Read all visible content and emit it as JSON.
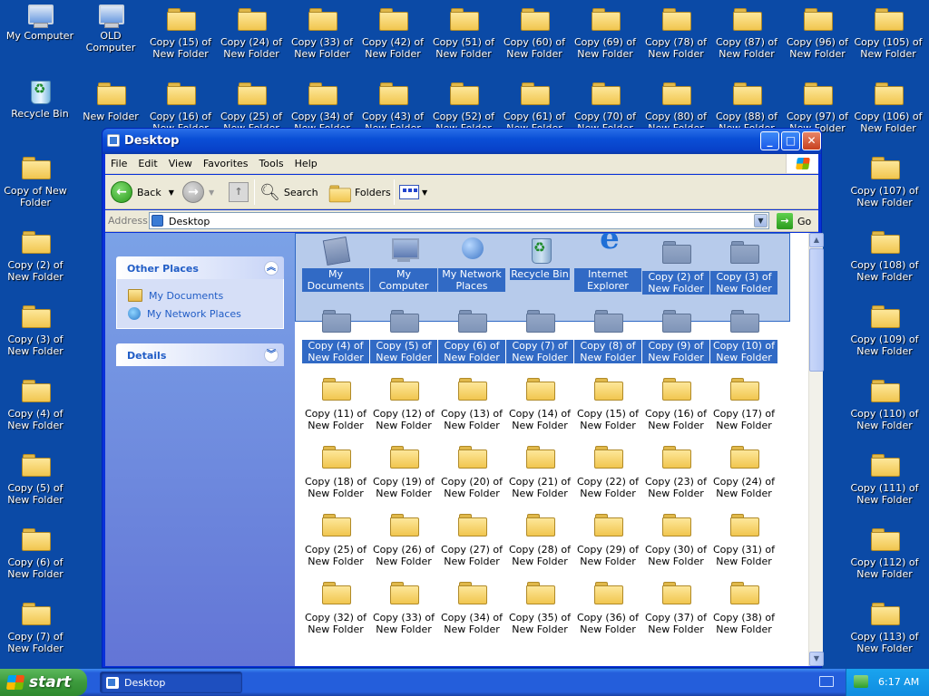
{
  "desktop": {
    "icons": [
      {
        "label": "My Computer",
        "type": "pc"
      },
      {
        "label": "OLD Computer",
        "type": "pc"
      },
      {
        "label": "Copy (15) of New Folder",
        "type": "folder"
      },
      {
        "label": "Copy (24) of New Folder",
        "type": "folder"
      },
      {
        "label": "Copy (33) of New Folder",
        "type": "folder"
      },
      {
        "label": "Copy (42) of New Folder",
        "type": "folder"
      },
      {
        "label": "Copy (51) of New Folder",
        "type": "folder"
      },
      {
        "label": "Copy (60) of New Folder",
        "type": "folder"
      },
      {
        "label": "Copy (69) of New Folder",
        "type": "folder"
      },
      {
        "label": "Copy (78) of New Folder",
        "type": "folder"
      },
      {
        "label": "Copy (87) of New Folder",
        "type": "folder"
      },
      {
        "label": "Copy (96) of New Folder",
        "type": "folder"
      },
      {
        "label": "Copy (105) of New Folder",
        "type": "folder"
      },
      {
        "label": "Recycle Bin",
        "type": "bin"
      },
      {
        "label": "New Folder",
        "type": "folder"
      },
      {
        "label": "Copy (16) of New Folder",
        "type": "folder"
      },
      {
        "label": "Copy (25) of New Folder",
        "type": "folder"
      },
      {
        "label": "Copy (34) of New Folder",
        "type": "folder"
      },
      {
        "label": "Copy (43) of New Folder",
        "type": "folder"
      },
      {
        "label": "Copy (52) of New Folder",
        "type": "folder"
      },
      {
        "label": "Copy (61) of New Folder",
        "type": "folder"
      },
      {
        "label": "Copy (70) of New Folder",
        "type": "folder"
      },
      {
        "label": "Copy (80) of New Folder",
        "type": "folder"
      },
      {
        "label": "Copy (88) of New Folder",
        "type": "folder"
      },
      {
        "label": "Copy (97) of New Folder",
        "type": "folder"
      },
      {
        "label": "Copy (106) of New Folder",
        "type": "folder"
      },
      {
        "label": "Copy of New Folder",
        "type": "folder"
      },
      {
        "label": "Copy (107) of New Folder",
        "type": "folder"
      },
      {
        "label": "Copy (2) of New Folder",
        "type": "folder"
      },
      {
        "label": "Copy (108) of New Folder",
        "type": "folder"
      },
      {
        "label": "Copy (3) of New Folder",
        "type": "folder"
      },
      {
        "label": "Copy (109) of New Folder",
        "type": "folder"
      },
      {
        "label": "Copy (4) of New Folder",
        "type": "folder"
      },
      {
        "label": "Copy (110) of New Folder",
        "type": "folder"
      },
      {
        "label": "Copy (5) of New Folder",
        "type": "folder"
      },
      {
        "label": "Copy (111) of New Folder",
        "type": "folder"
      },
      {
        "label": "Copy (6) of New Folder",
        "type": "folder"
      },
      {
        "label": "Copy (112) of New Folder",
        "type": "folder"
      },
      {
        "label": "Copy (7) of New Folder",
        "type": "folder"
      },
      {
        "label": "Copy (113) of New Folder",
        "type": "folder"
      }
    ]
  },
  "window": {
    "title": "Desktop",
    "menu": [
      "File",
      "Edit",
      "View",
      "Favorites",
      "Tools",
      "Help"
    ],
    "toolbar": {
      "back": "Back",
      "search": "Search",
      "folders": "Folders"
    },
    "address": {
      "label": "Address",
      "value": "Desktop",
      "go": "Go"
    },
    "left_pane": {
      "other_places": {
        "title": "Other Places",
        "links": [
          "My Documents",
          "My Network Places"
        ]
      },
      "details": {
        "title": "Details"
      }
    },
    "items": [
      {
        "label": "My Documents",
        "icon": "doc",
        "selected": true
      },
      {
        "label": "My Computer",
        "icon": "comp",
        "selected": true
      },
      {
        "label": "My Network Places",
        "icon": "net",
        "selected": true
      },
      {
        "label": "Recycle Bin",
        "icon": "bin",
        "selected": true
      },
      {
        "label": "Internet Explorer",
        "icon": "ie",
        "selected": true
      },
      {
        "label": "Copy (2) of New Folder",
        "icon": "folder",
        "selected": true
      },
      {
        "label": "Copy (3) of New Folder",
        "icon": "folder",
        "selected": true
      },
      {
        "label": "Copy (4) of New Folder",
        "icon": "folder",
        "selected": true
      },
      {
        "label": "Copy (5) of New Folder",
        "icon": "folder",
        "selected": true
      },
      {
        "label": "Copy (6) of New Folder",
        "icon": "folder",
        "selected": true
      },
      {
        "label": "Copy (7) of New Folder",
        "icon": "folder",
        "selected": true
      },
      {
        "label": "Copy (8) of New Folder",
        "icon": "folder",
        "selected": true
      },
      {
        "label": "Copy (9) of New Folder",
        "icon": "folder",
        "selected": true
      },
      {
        "label": "Copy (10) of New Folder",
        "icon": "folder",
        "selected": true
      },
      {
        "label": "Copy (11) of New Folder",
        "icon": "folder",
        "selected": false
      },
      {
        "label": "Copy (12) of New Folder",
        "icon": "folder",
        "selected": false
      },
      {
        "label": "Copy (13) of New Folder",
        "icon": "folder",
        "selected": false
      },
      {
        "label": "Copy (14) of New Folder",
        "icon": "folder",
        "selected": false
      },
      {
        "label": "Copy (15) of New Folder",
        "icon": "folder",
        "selected": false
      },
      {
        "label": "Copy (16) of New Folder",
        "icon": "folder",
        "selected": false
      },
      {
        "label": "Copy (17) of New Folder",
        "icon": "folder",
        "selected": false
      },
      {
        "label": "Copy (18) of New Folder",
        "icon": "folder",
        "selected": false
      },
      {
        "label": "Copy (19) of New Folder",
        "icon": "folder",
        "selected": false
      },
      {
        "label": "Copy (20) of New Folder",
        "icon": "folder",
        "selected": false
      },
      {
        "label": "Copy (21) of New Folder",
        "icon": "folder",
        "selected": false
      },
      {
        "label": "Copy (22) of New Folder",
        "icon": "folder",
        "selected": false
      },
      {
        "label": "Copy (23) of New Folder",
        "icon": "folder",
        "selected": false
      },
      {
        "label": "Copy (24) of New Folder",
        "icon": "folder",
        "selected": false
      },
      {
        "label": "Copy (25) of New Folder",
        "icon": "folder",
        "selected": false
      },
      {
        "label": "Copy (26) of New Folder",
        "icon": "folder",
        "selected": false
      },
      {
        "label": "Copy (27) of New Folder",
        "icon": "folder",
        "selected": false
      },
      {
        "label": "Copy (28) of New Folder",
        "icon": "folder",
        "selected": false
      },
      {
        "label": "Copy (29) of New Folder",
        "icon": "folder",
        "selected": false
      },
      {
        "label": "Copy (30) of New Folder",
        "icon": "folder",
        "selected": false
      },
      {
        "label": "Copy (31) of New Folder",
        "icon": "folder",
        "selected": false
      },
      {
        "label": "Copy (32) of New Folder",
        "icon": "folder",
        "selected": false
      },
      {
        "label": "Copy (33) of New Folder",
        "icon": "folder",
        "selected": false
      },
      {
        "label": "Copy (34) of New Folder",
        "icon": "folder",
        "selected": false
      },
      {
        "label": "Copy (35) of New Folder",
        "icon": "folder",
        "selected": false
      },
      {
        "label": "Copy (36) of New Folder",
        "icon": "folder",
        "selected": false
      },
      {
        "label": "Copy (37) of New Folder",
        "icon": "folder",
        "selected": false
      },
      {
        "label": "Copy (38) of New Folder",
        "icon": "folder",
        "selected": false
      }
    ]
  },
  "taskbar": {
    "start": "start",
    "task": "Desktop",
    "clock": "6:17 AM"
  }
}
